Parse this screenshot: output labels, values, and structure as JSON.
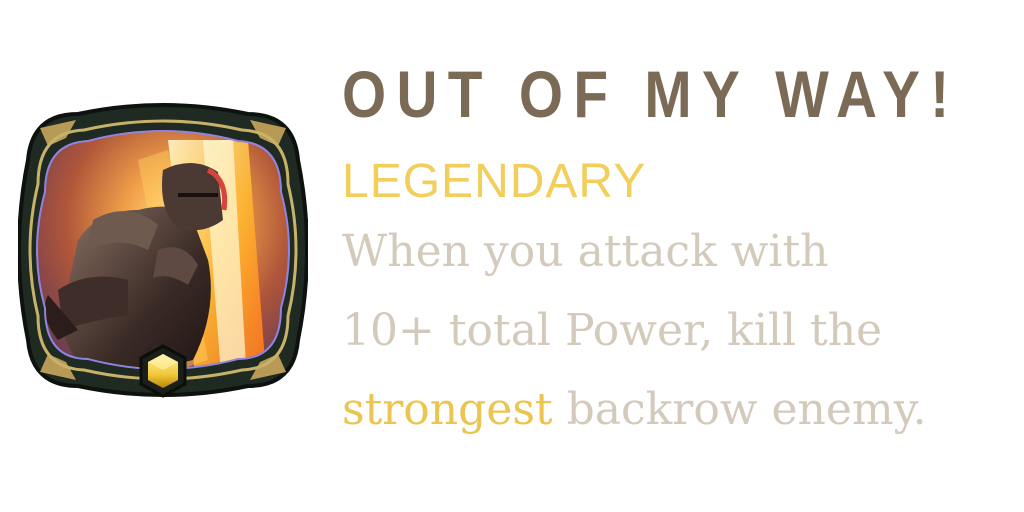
{
  "card": {
    "title": "OUT OF MY WAY!",
    "rarity": "LEGENDARY",
    "description": {
      "line1": "When you attack with",
      "line2": "10+ total Power, kill the",
      "line3_highlight": "strongest",
      "line3_rest": " backrow enemy."
    },
    "icon": "armored-champion-art",
    "gem_icon": "hexagon-gem-icon"
  },
  "colors": {
    "title": "#7a6a56",
    "rarity": "#f1cf5a",
    "description": "#d3cabc",
    "highlight": "#ebc54f",
    "frame_dark": "#1f2a22",
    "frame_gold": "#b79a55",
    "gem": "#f2c83a"
  }
}
